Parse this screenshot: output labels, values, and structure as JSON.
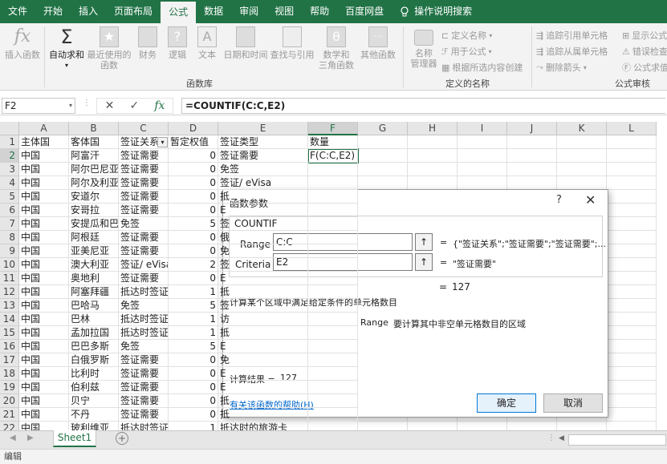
{
  "tabs": [
    "文件",
    "开始",
    "插入",
    "页面布局",
    "公式",
    "数据",
    "审阅",
    "视图",
    "帮助",
    "百度网盘"
  ],
  "active_tab": "公式",
  "tell_me": "操作说明搜索",
  "ribbon": {
    "insert_function": "插入函数",
    "autosum": "自动求和",
    "recent_line1": "最近使用的",
    "recent_line2": "函数",
    "financial": "财务",
    "logical": "逻辑",
    "text": "文本",
    "datetime": "日期和时间",
    "lookup": "查找与引用",
    "math_line1": "数学和",
    "math_line2": "三角函数",
    "other": "其他函数",
    "name_mgr_line1": "名称",
    "name_mgr_line2": "管理器",
    "define_name": "定义名称",
    "use_in_formula": "用于公式",
    "create_from_sel": "根据所选内容创建",
    "trace_precedents": "追踪引用单元格",
    "trace_dependents": "追踪从属单元格",
    "remove_arrows": "删除箭头",
    "show_formulas": "显示公式",
    "error_check": "错误检查",
    "eval_formula": "公式求值",
    "group_library": "函数库",
    "group_names": "定义的名称",
    "group_audit": "公式审核"
  },
  "formula_bar": {
    "name_box": "F2",
    "formula": "=COUNTIF(C:C,E2)"
  },
  "columns": [
    "A",
    "B",
    "C",
    "D",
    "E",
    "F",
    "G",
    "H",
    "I",
    "J",
    "K",
    "L"
  ],
  "rows": [
    {
      "n": "1",
      "a": "主体国",
      "b": "客体国",
      "c": "签证关系",
      "d": "暂定权值",
      "e": "签证类型",
      "f": "数量"
    },
    {
      "n": "2",
      "a": "中国",
      "b": "阿富汗",
      "c": "签证需要",
      "d": "0",
      "e": "签证需要",
      "f": "F(C:C,E2)"
    },
    {
      "n": "3",
      "a": "中国",
      "b": "阿尔巴尼亚",
      "c": "签证需要",
      "d": "0",
      "e": "免签",
      "f": ""
    },
    {
      "n": "4",
      "a": "中国",
      "b": "阿尔及利亚",
      "c": "签证需要",
      "d": "0",
      "e": "签证/ eVisa",
      "f": ""
    },
    {
      "n": "5",
      "a": "中国",
      "b": "安道尔",
      "c": "签证需要",
      "d": "0",
      "e": "抵",
      "f": ""
    },
    {
      "n": "6",
      "a": "中国",
      "b": "安哥拉",
      "c": "签证需要",
      "d": "0",
      "e": "E",
      "f": ""
    },
    {
      "n": "7",
      "a": "中国",
      "b": "安提瓜和巴布达",
      "c": "免签",
      "d": "5",
      "e": "签",
      "f": ""
    },
    {
      "n": "8",
      "a": "中国",
      "b": "阿根廷",
      "c": "签证需要",
      "d": "0",
      "e": "俄",
      "f": ""
    },
    {
      "n": "9",
      "a": "中国",
      "b": "亚美尼亚",
      "c": "签证需要",
      "d": "0",
      "e": "免",
      "f": ""
    },
    {
      "n": "10",
      "a": "中国",
      "b": "澳大利亚",
      "c": "签证/ eVisa",
      "d": "2",
      "e": "签",
      "f": ""
    },
    {
      "n": "11",
      "a": "中国",
      "b": "奥地利",
      "c": "签证需要",
      "d": "0",
      "e": "E",
      "f": ""
    },
    {
      "n": "12",
      "a": "中国",
      "b": "阿塞拜疆",
      "c": "抵达时签证",
      "d": "1",
      "e": "抵",
      "f": ""
    },
    {
      "n": "13",
      "a": "中国",
      "b": "巴哈马",
      "c": "免签",
      "d": "5",
      "e": "签",
      "f": ""
    },
    {
      "n": "14",
      "a": "中国",
      "b": "巴林",
      "c": "抵达时签证",
      "d": "1",
      "e": "访",
      "f": ""
    },
    {
      "n": "15",
      "a": "中国",
      "b": "孟加拉国",
      "c": "抵达时签证",
      "d": "1",
      "e": "抵",
      "f": ""
    },
    {
      "n": "16",
      "a": "中国",
      "b": "巴巴多斯",
      "c": "免签",
      "d": "5",
      "e": "E",
      "f": ""
    },
    {
      "n": "17",
      "a": "中国",
      "b": "白俄罗斯",
      "c": "签证需要",
      "d": "0",
      "e": "免",
      "f": ""
    },
    {
      "n": "18",
      "a": "中国",
      "b": "比利时",
      "c": "签证需要",
      "d": "0",
      "e": "E",
      "f": ""
    },
    {
      "n": "19",
      "a": "中国",
      "b": "伯利兹",
      "c": "签证需要",
      "d": "0",
      "e": "E",
      "f": ""
    },
    {
      "n": "20",
      "a": "中国",
      "b": "贝宁",
      "c": "签证需要",
      "d": "0",
      "e": "抵",
      "f": ""
    },
    {
      "n": "21",
      "a": "中国",
      "b": "不丹",
      "c": "签证需要",
      "d": "0",
      "e": "抵",
      "f": ""
    },
    {
      "n": "22",
      "a": "中国",
      "b": "玻利维亚",
      "c": "抵达时签证",
      "d": "1",
      "e": "抵达时的旅游卡",
      "f": ""
    }
  ],
  "sheet_tab": "Sheet1",
  "status": "编辑",
  "dialog": {
    "title": "函数参数",
    "help_glyph": "?",
    "close_glyph": "✕",
    "function_name": "COUNTIF",
    "arg1_label": "Range",
    "arg1_value": "C:C",
    "arg1_result": "{\"签证关系\";\"签证需要\";\"签证需要\";...",
    "arg2_label": "Criteria",
    "arg2_value": "E2",
    "arg2_result": "\"签证需要\"",
    "eq": "=",
    "total": "127",
    "description": "计算某个区域中满足给定条件的单元格数目",
    "arg_help_name": "Range",
    "arg_help_text": "要计算其中非空单元格数目的区域",
    "result_label": "计算结果 =",
    "result_value": "127",
    "help_link": "有关该函数的帮助(H)",
    "ok": "确定",
    "cancel": "取消"
  }
}
